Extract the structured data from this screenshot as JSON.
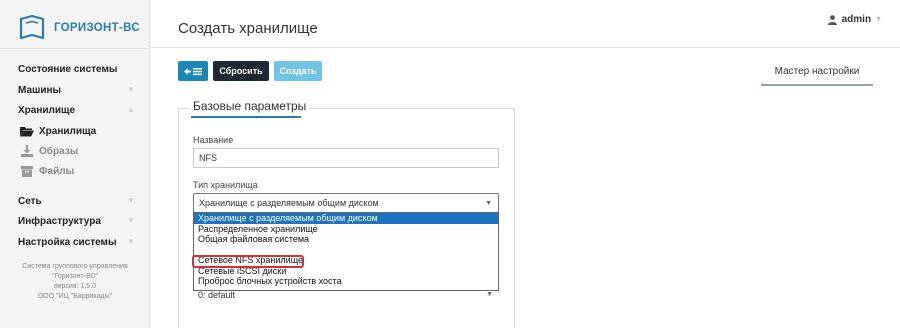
{
  "brand": {
    "name": "ГОРИЗОНТ-ВС",
    "color": "#2a7bb5"
  },
  "header": {
    "title": "Создать хранилище",
    "user": "admin"
  },
  "sidebar": {
    "items": [
      {
        "label": "Состояние системы"
      },
      {
        "label": "Машины"
      },
      {
        "label": "Хранилище"
      },
      {
        "label": "Сеть"
      },
      {
        "label": "Инфраструктура"
      },
      {
        "label": "Настройка системы"
      }
    ],
    "sub": [
      {
        "label": "Хранилища",
        "icon": "folder-open-icon"
      },
      {
        "label": "Образы",
        "icon": "download-icon"
      },
      {
        "label": "Файлы",
        "icon": "archive-icon"
      }
    ],
    "footer": {
      "line1": "Система группового управления",
      "line2": "\"Горизонт-ВС\"",
      "line3": "версия: 1.5.0",
      "line4": "ООО \"ИЦ \"Баррикады\""
    }
  },
  "toolbar": {
    "back_label": "←≡",
    "reset_label": "Сбросить",
    "create_label": "Создать"
  },
  "wizard": {
    "tab_label": "Мастер настройки"
  },
  "form": {
    "legend": "Базовые параметры",
    "name_label": "Название",
    "name_value": "NFS",
    "type_label": "Тип хранилища",
    "type_value": "Хранилище с разделяемым общим диском",
    "options": [
      "Хранилище с разделяемым общим диском",
      "Распределенное хранилище",
      "Общая файловая система",
      "",
      "Сетевое NFS хранилище",
      "Сетевые iSCSI диски",
      "Проброс блочных устройств хоста"
    ],
    "lower_select_value": "0: default"
  },
  "colors": {
    "primary": "#1a87b5",
    "dark": "#1c2834",
    "light": "#6ec4e6",
    "highlight": "#1e73be",
    "marker": "#d9302b"
  }
}
